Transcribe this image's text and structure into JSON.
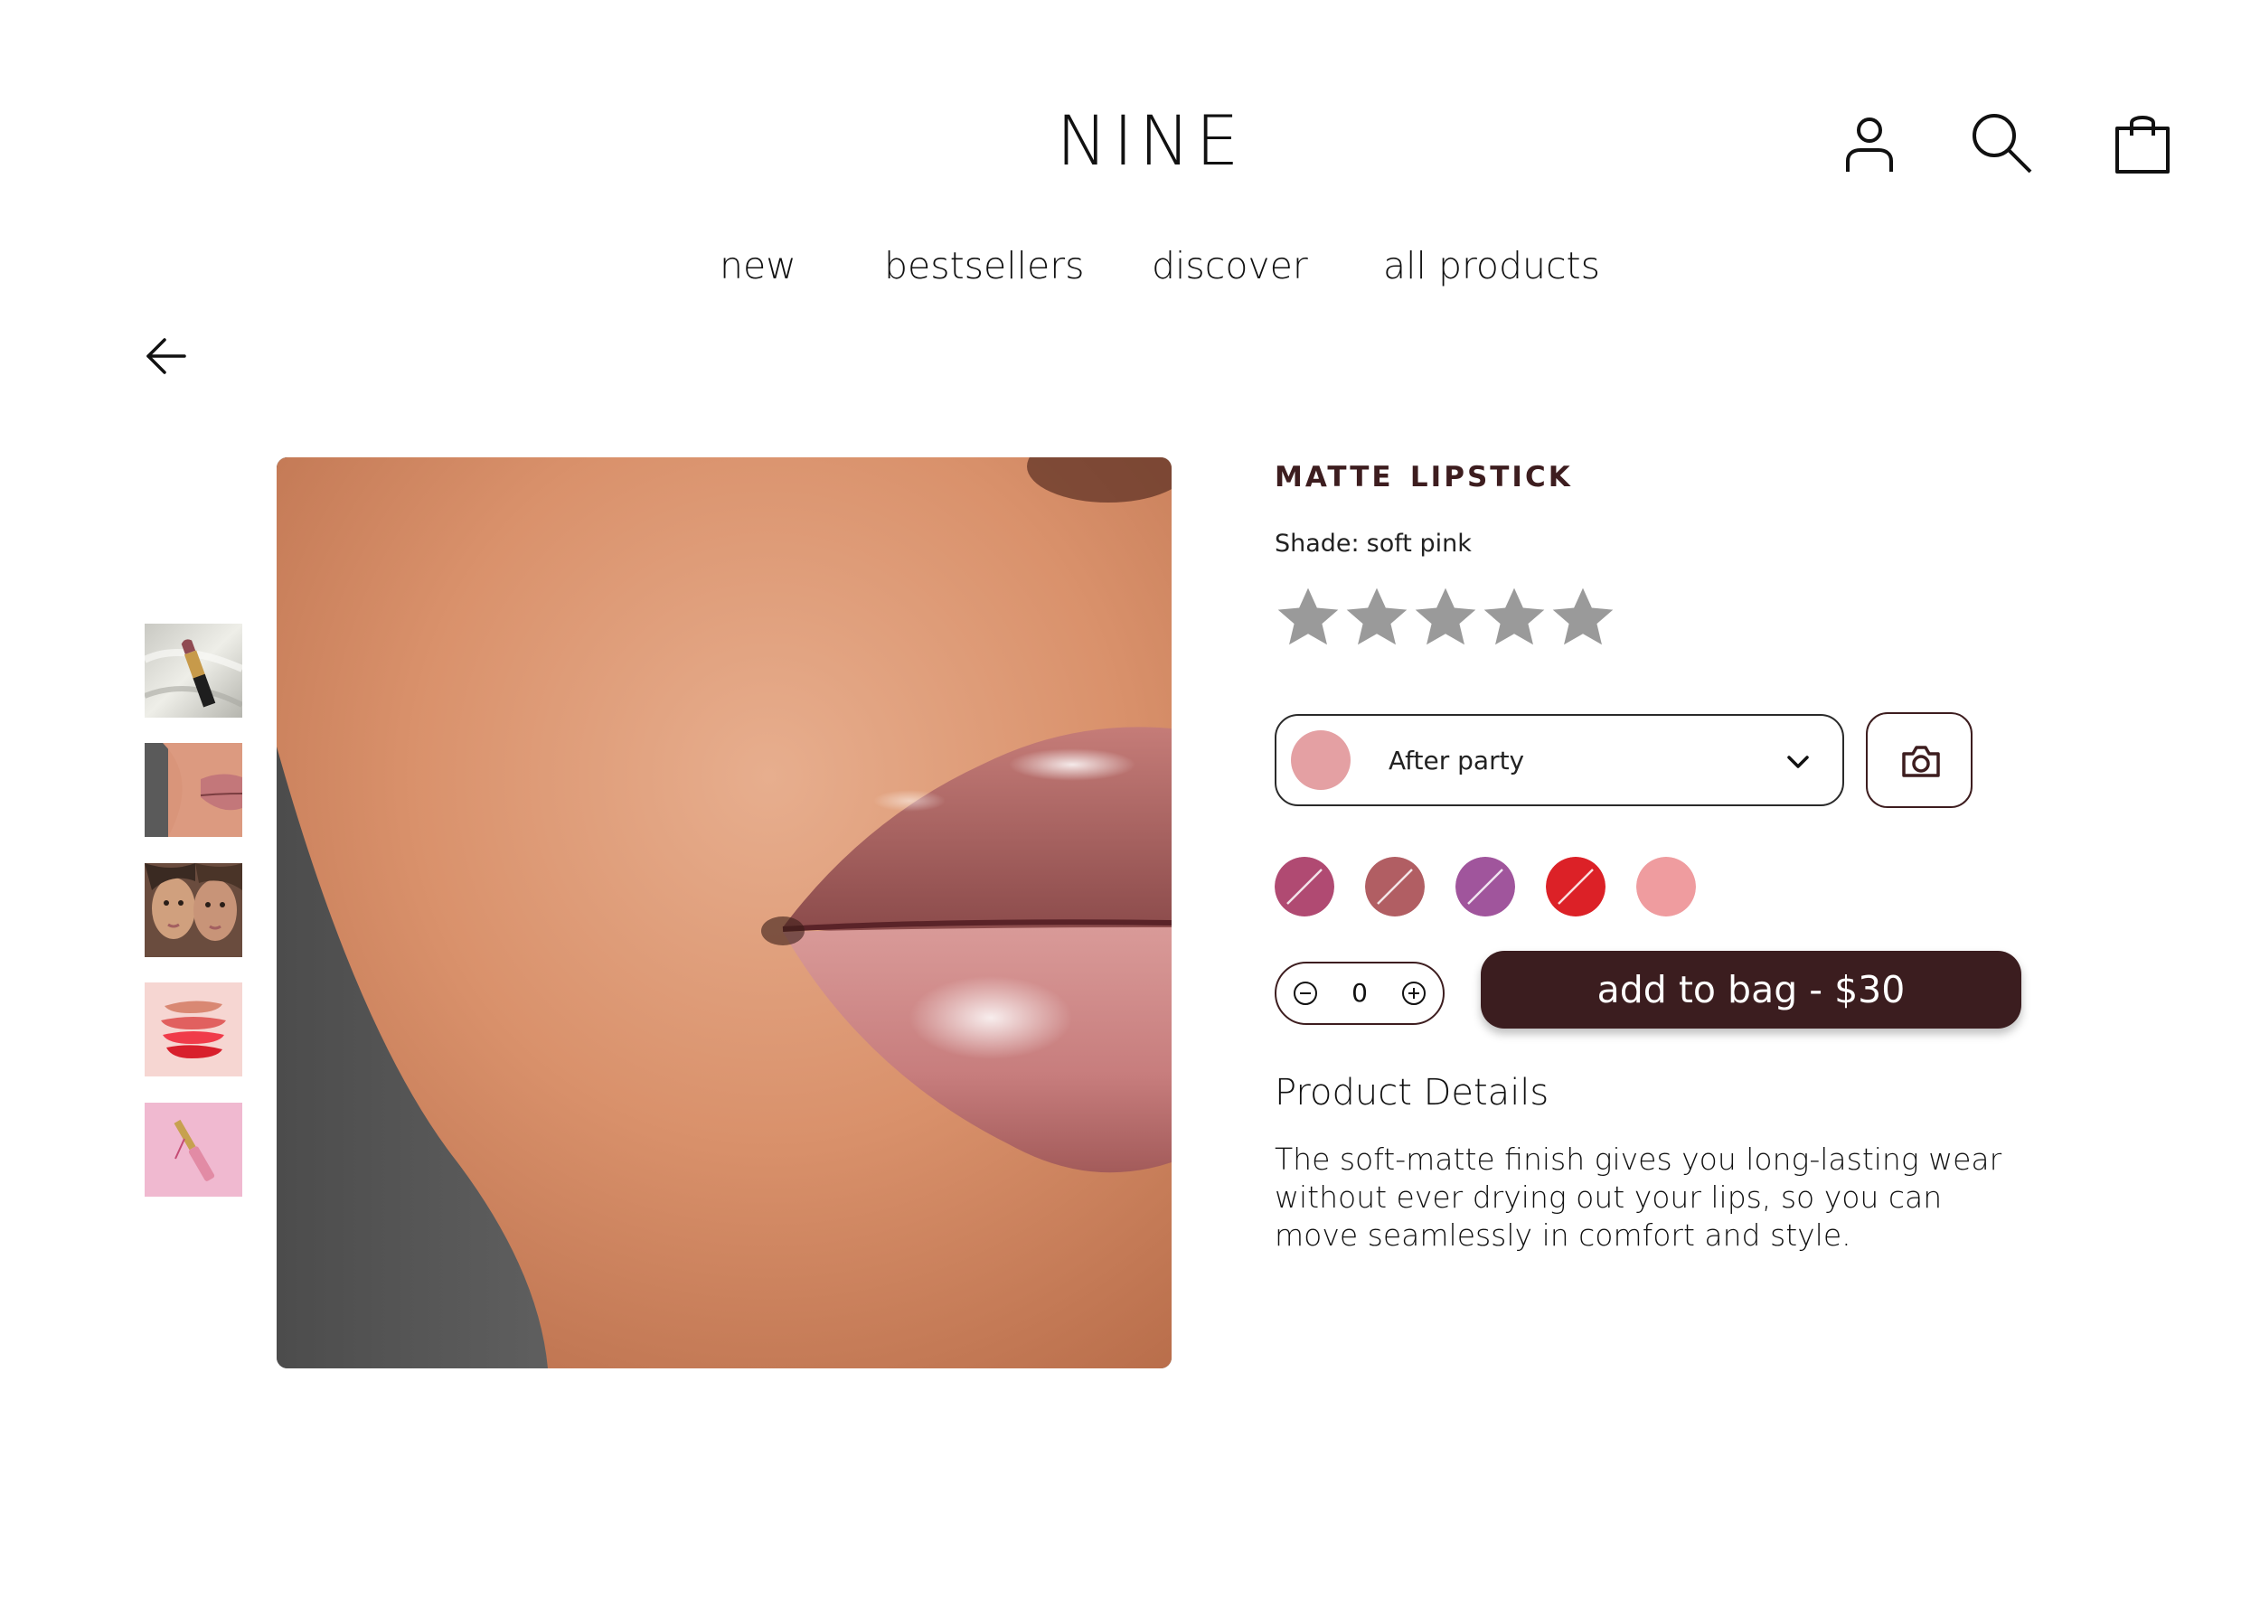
{
  "header": {
    "brand": "NINE",
    "icons": [
      "account-icon",
      "search-icon",
      "shopping-bag-icon"
    ]
  },
  "nav": {
    "items": [
      {
        "label": "new"
      },
      {
        "label": "bestsellers"
      },
      {
        "label": "discover"
      },
      {
        "label": "all products"
      }
    ]
  },
  "back": {
    "icon": "arrow-left-icon"
  },
  "gallery": {
    "thumbnails": [
      "lipstick-on-silk",
      "lips-closeup",
      "two-models",
      "lipstick-smears",
      "lip-gloss-on-pink"
    ],
    "main_image": "glossy-lips-closeup"
  },
  "product": {
    "title": "matte lipstick",
    "shade_label": "Shade:",
    "shade_value": "soft pink",
    "rating": {
      "filled": 5,
      "out_of": 5,
      "color": "#9a9a9a"
    },
    "shade_selector": {
      "selected": "After party",
      "color": "#e4a0a3"
    },
    "camera_icon": "camera-icon",
    "swatches": [
      {
        "color": "#b04a72",
        "available": false
      },
      {
        "color": "#b15e63",
        "available": false
      },
      {
        "color": "#a0559c",
        "available": false
      },
      {
        "color": "#dc2127",
        "available": false
      },
      {
        "color": "#ef9c9f",
        "available": true
      }
    ],
    "quantity": "0",
    "add_to_bag": "add to bag - $30",
    "details_heading": "Product Details",
    "details_text": "The soft-matte finish gives you long-lasting wear without ever drying out your lips, so you can move seamlessly in comfort and style."
  },
  "colors": {
    "accent": "#3b1d1f"
  }
}
